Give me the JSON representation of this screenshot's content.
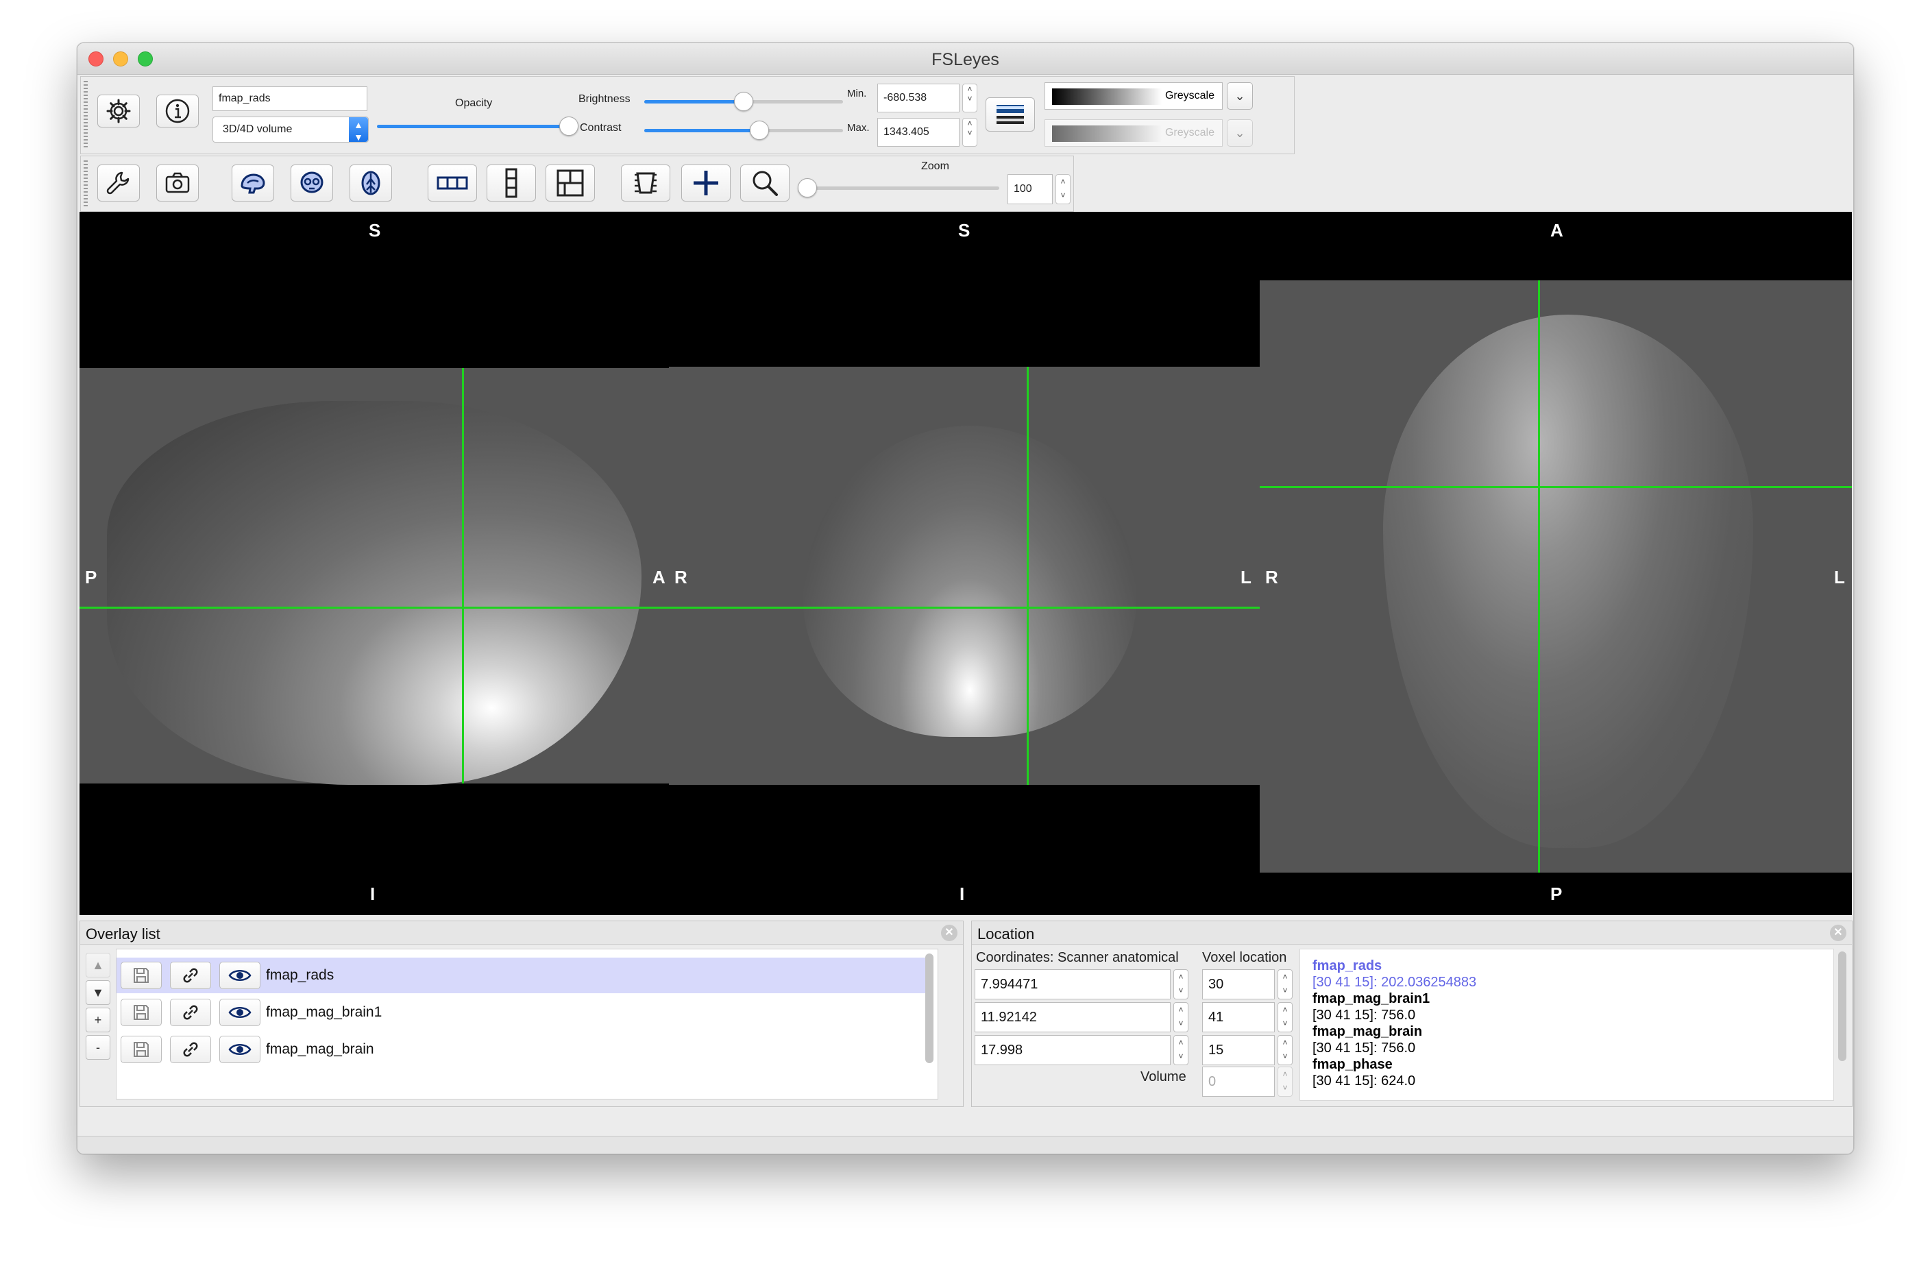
{
  "window": {
    "title": "FSLeyes"
  },
  "overlay_toolbar": {
    "overlay_name": "fmap_rads",
    "overlay_type": "3D/4D volume",
    "opacity_label": "Opacity",
    "opacity": 1.0,
    "brightness_label": "Brightness",
    "brightness": 0.5,
    "contrast_label": "Contrast",
    "contrast": 0.58,
    "min_label": "Min.",
    "min_value": "-680.538",
    "max_label": "Max.",
    "max_value": "1343.405",
    "colormap": "Greyscale",
    "neg_colormap": "Greyscale"
  },
  "view_toolbar": {
    "zoom_label": "Zoom",
    "zoom_value": "100",
    "zoom": 0.0
  },
  "views": {
    "sagittal": {
      "top": "S",
      "bottom": "I",
      "left": "P",
      "right": "A"
    },
    "coronal": {
      "top": "S",
      "bottom": "I",
      "left": "R",
      "right": "L"
    },
    "axial": {
      "top": "A",
      "bottom": "P",
      "left": "R",
      "right": "L"
    }
  },
  "colors": {
    "crosshair": "#1fd21f",
    "selection": "#d7d9fb",
    "accent": "#2f8cf2"
  },
  "overlay_list": {
    "title": "Overlay list",
    "items": [
      {
        "name": "fmap_rads",
        "selected": true
      },
      {
        "name": "fmap_mag_brain1",
        "selected": false
      },
      {
        "name": "fmap_mag_brain",
        "selected": false
      }
    ],
    "side_buttons": [
      "▲",
      "▼",
      "+",
      "-"
    ]
  },
  "location": {
    "title": "Location",
    "coord_label": "Coordinates: Scanner anatomical",
    "voxel_label": "Voxel location",
    "coords": [
      "7.994471",
      "11.92142",
      "17.998"
    ],
    "voxels": [
      "30",
      "41",
      "15"
    ],
    "volume_label": "Volume",
    "volume_value": "0",
    "info": [
      {
        "name": "fmap_rads",
        "value": "[30 41 15]: 202.036254883"
      },
      {
        "name": "fmap_mag_brain1",
        "value": "[30 41 15]: 756.0"
      },
      {
        "name": "fmap_mag_brain",
        "value": "[30 41 15]: 756.0"
      },
      {
        "name": "fmap_phase",
        "value": "[30 41 15]: 624.0"
      }
    ]
  }
}
